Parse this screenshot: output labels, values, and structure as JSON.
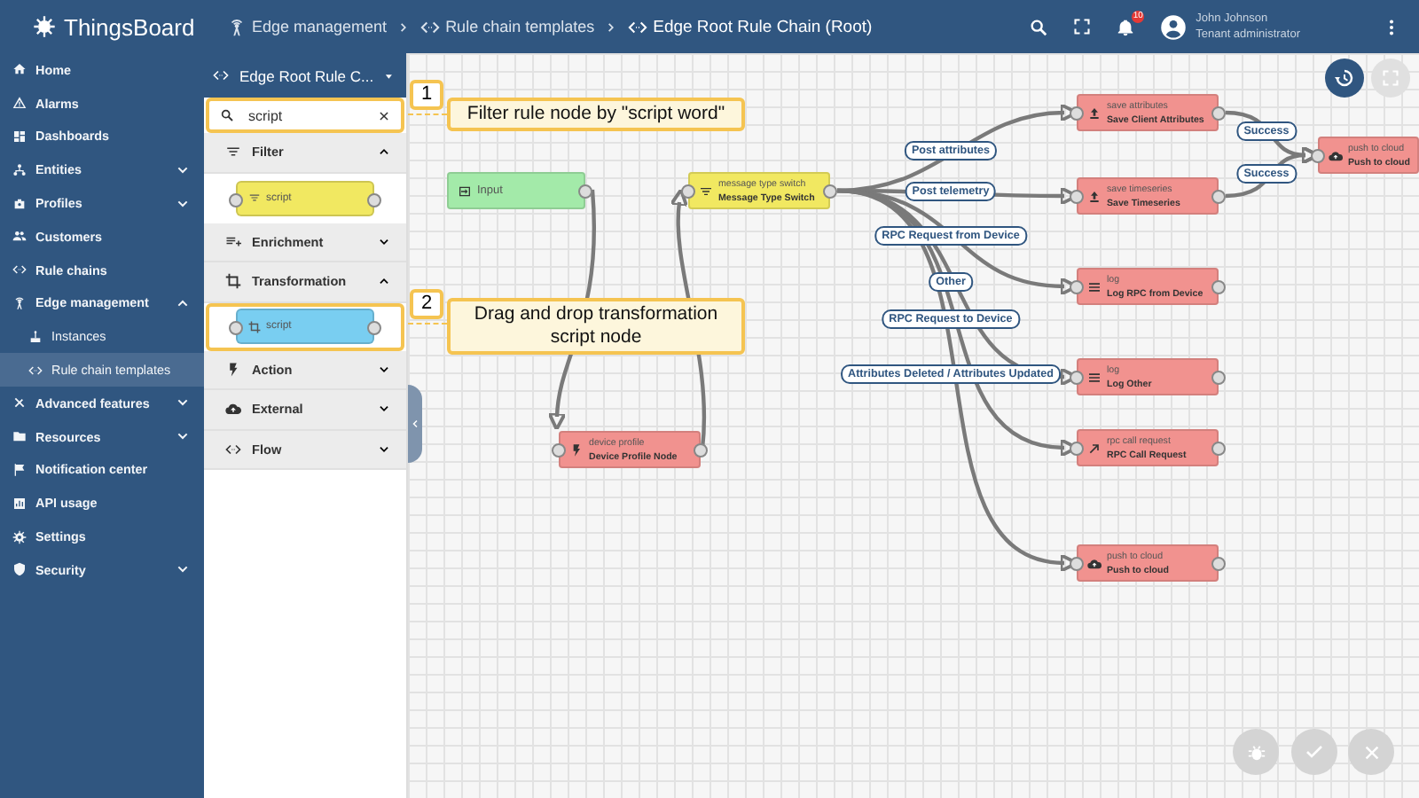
{
  "app": {
    "title": "ThingsBoard"
  },
  "breadcrumbs": [
    {
      "label": "Edge management"
    },
    {
      "label": "Rule chain templates"
    },
    {
      "label": "Edge Root Rule Chain (Root)"
    }
  ],
  "notifications": {
    "count": "10"
  },
  "user": {
    "name": "John Johnson",
    "role": "Tenant administrator"
  },
  "sidebar": {
    "items": [
      {
        "label": "Home",
        "selected": false
      },
      {
        "label": "Alarms",
        "selected": false
      },
      {
        "label": "Dashboards",
        "selected": false
      },
      {
        "label": "Entities",
        "selected": false,
        "expanded": false
      },
      {
        "label": "Profiles",
        "selected": false,
        "expanded": false
      },
      {
        "label": "Customers",
        "selected": false
      },
      {
        "label": "Rule chains",
        "selected": false
      },
      {
        "label": "Edge management",
        "selected": false,
        "expanded": true,
        "children": [
          {
            "label": "Instances",
            "selected": false
          },
          {
            "label": "Rule chain templates",
            "selected": true
          }
        ]
      },
      {
        "label": "Advanced features",
        "selected": false,
        "expanded": false
      },
      {
        "label": "Resources",
        "selected": false,
        "expanded": false
      },
      {
        "label": "Notification center",
        "selected": false
      },
      {
        "label": "API usage",
        "selected": false
      },
      {
        "label": "Settings",
        "selected": false
      },
      {
        "label": "Security",
        "selected": false,
        "expanded": false
      }
    ]
  },
  "library": {
    "chain_selector": "Edge Root Rule C...",
    "search": {
      "value": "script",
      "highlighted": true
    },
    "sections": [
      {
        "kind": "filter",
        "label": "Filter",
        "expanded": true,
        "nodes": [
          {
            "label": "script",
            "highlighted": false
          }
        ]
      },
      {
        "kind": "enrichment",
        "label": "Enrichment",
        "expanded": false
      },
      {
        "kind": "transformation",
        "label": "Transformation",
        "expanded": true,
        "nodes": [
          {
            "label": "script",
            "highlighted": true
          }
        ]
      },
      {
        "kind": "action",
        "label": "Action",
        "expanded": false
      },
      {
        "kind": "external",
        "label": "External",
        "expanded": false
      },
      {
        "kind": "flow",
        "label": "Flow",
        "expanded": false
      }
    ]
  },
  "canvas": {
    "nodes": [
      {
        "kind": "input",
        "name": "Input"
      },
      {
        "kind": "filter",
        "type": "message type switch",
        "name": "Message Type Switch"
      },
      {
        "kind": "action",
        "type": "device profile",
        "name": "Device Profile Node"
      },
      {
        "kind": "action",
        "type": "save attributes",
        "name": "Save Client Attributes"
      },
      {
        "kind": "action",
        "type": "save timeseries",
        "name": "Save Timeseries"
      },
      {
        "kind": "action",
        "type": "log",
        "name": "Log RPC from Device"
      },
      {
        "kind": "action",
        "type": "log",
        "name": "Log Other"
      },
      {
        "kind": "action",
        "type": "rpc call request",
        "name": "RPC Call Request"
      },
      {
        "kind": "external",
        "type": "push to cloud",
        "name": "Push to cloud"
      },
      {
        "kind": "external",
        "type": "push to cloud",
        "name": "Push to cloud"
      }
    ],
    "links": [
      {
        "label": "Post attributes"
      },
      {
        "label": "Post telemetry"
      },
      {
        "label": "RPC Request from Device"
      },
      {
        "label": "Other"
      },
      {
        "label": "RPC Request to Device"
      },
      {
        "label": "Attributes Deleted / Attributes Updated"
      },
      {
        "label": "Success"
      },
      {
        "label": "Success"
      }
    ],
    "callouts": [
      {
        "number": "1",
        "text": "Filter rule node by \"script word\""
      },
      {
        "number": "2",
        "text": "Drag and drop  transformation script node"
      }
    ]
  }
}
